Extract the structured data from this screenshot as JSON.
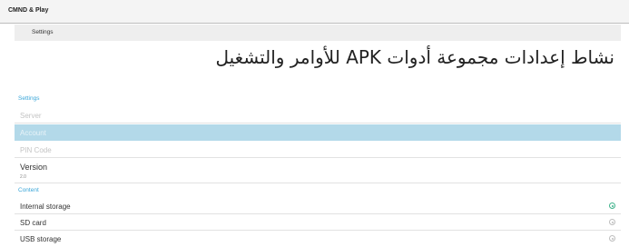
{
  "appbar": {
    "title": "CMND & Play"
  },
  "subbar": {
    "title": "Settings"
  },
  "page": {
    "title": "نشاط إعدادات مجموعة أدوات APK للأوامر والتشغيل"
  },
  "settings_section": {
    "header": "Settings",
    "items": [
      {
        "label": "Server",
        "state": "disabled"
      },
      {
        "label": "Account",
        "state": "selected"
      },
      {
        "label": "PIN Code",
        "state": "disabled"
      },
      {
        "label": "Version",
        "state": "normal",
        "summary": "2.0"
      }
    ]
  },
  "content_section": {
    "header": "Content",
    "items": [
      {
        "label": "Internal storage",
        "checked": true
      },
      {
        "label": "SD card",
        "checked": false
      },
      {
        "label": "USB storage",
        "checked": false
      }
    ]
  },
  "colors": {
    "accent": "#3aa6d8",
    "selected_row": "#b3d9e9",
    "radio_checked": "#3fb28b"
  }
}
